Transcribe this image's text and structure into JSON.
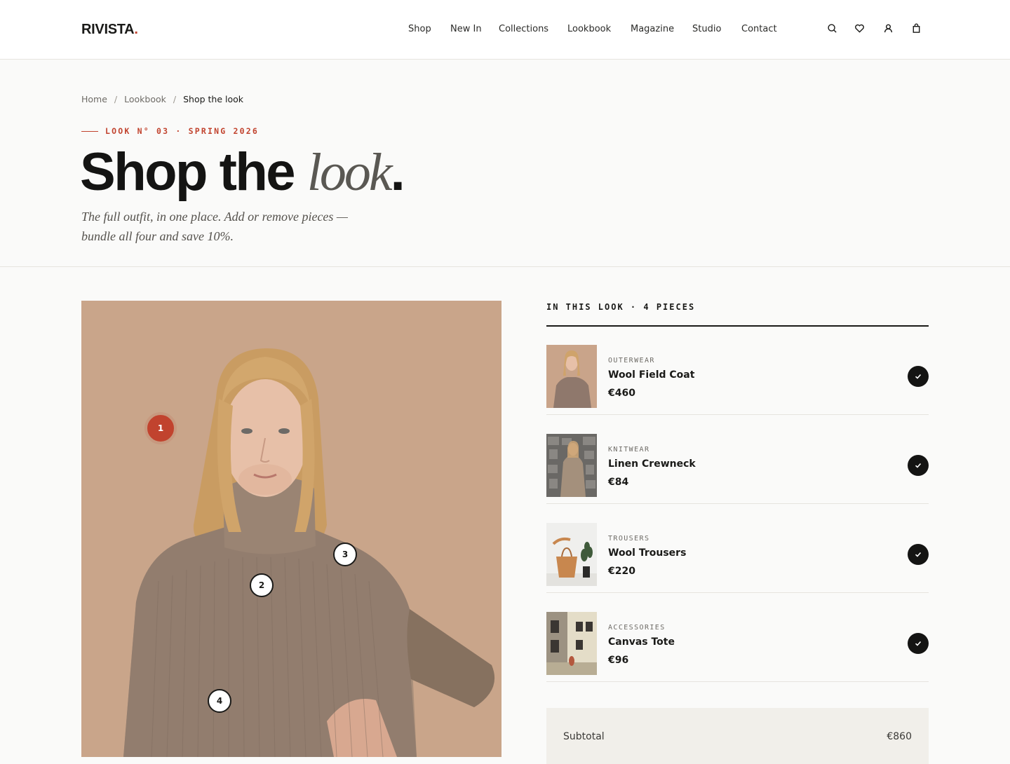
{
  "brand": {
    "name": "RIVISTA",
    "dot": ".",
    "accent": "#c1432e"
  },
  "nav": [
    {
      "label": "Shop"
    },
    {
      "label": "New In"
    },
    {
      "label": "Collections"
    },
    {
      "label": "Lookbook"
    },
    {
      "label": "Magazine"
    },
    {
      "label": "Studio"
    },
    {
      "label": "Contact"
    }
  ],
  "header_icons": [
    "search-icon",
    "heart-icon",
    "user-icon",
    "bag-icon"
  ],
  "breadcrumb": {
    "items": [
      "Home",
      "Lookbook",
      "Shop the look"
    ],
    "separator": "/"
  },
  "hero": {
    "eyebrow": "LOOK N° 03 · SPRING 2026",
    "title_main": "Shop the ",
    "title_italic": "look",
    "title_end": ".",
    "subtitle": "The full outfit, in one place. Add or remove pieces — bundle all four and save 10%."
  },
  "hotspots": [
    "1",
    "2",
    "3",
    "4"
  ],
  "panel": {
    "heading": "IN THIS LOOK · 4 PIECES",
    "items": [
      {
        "category": "OUTERWEAR",
        "name": "Wool Field Coat",
        "price": "€460",
        "selected": true
      },
      {
        "category": "KNITWEAR",
        "name": "Linen Crewneck",
        "price": "€84",
        "selected": true
      },
      {
        "category": "TROUSERS",
        "name": "Wool Trousers",
        "price": "€220",
        "selected": true
      },
      {
        "category": "ACCESSORIES",
        "name": "Canvas Tote",
        "price": "€96",
        "selected": true
      }
    ]
  },
  "summary": {
    "subtotal_label": "Subtotal",
    "subtotal_value": "€860"
  }
}
